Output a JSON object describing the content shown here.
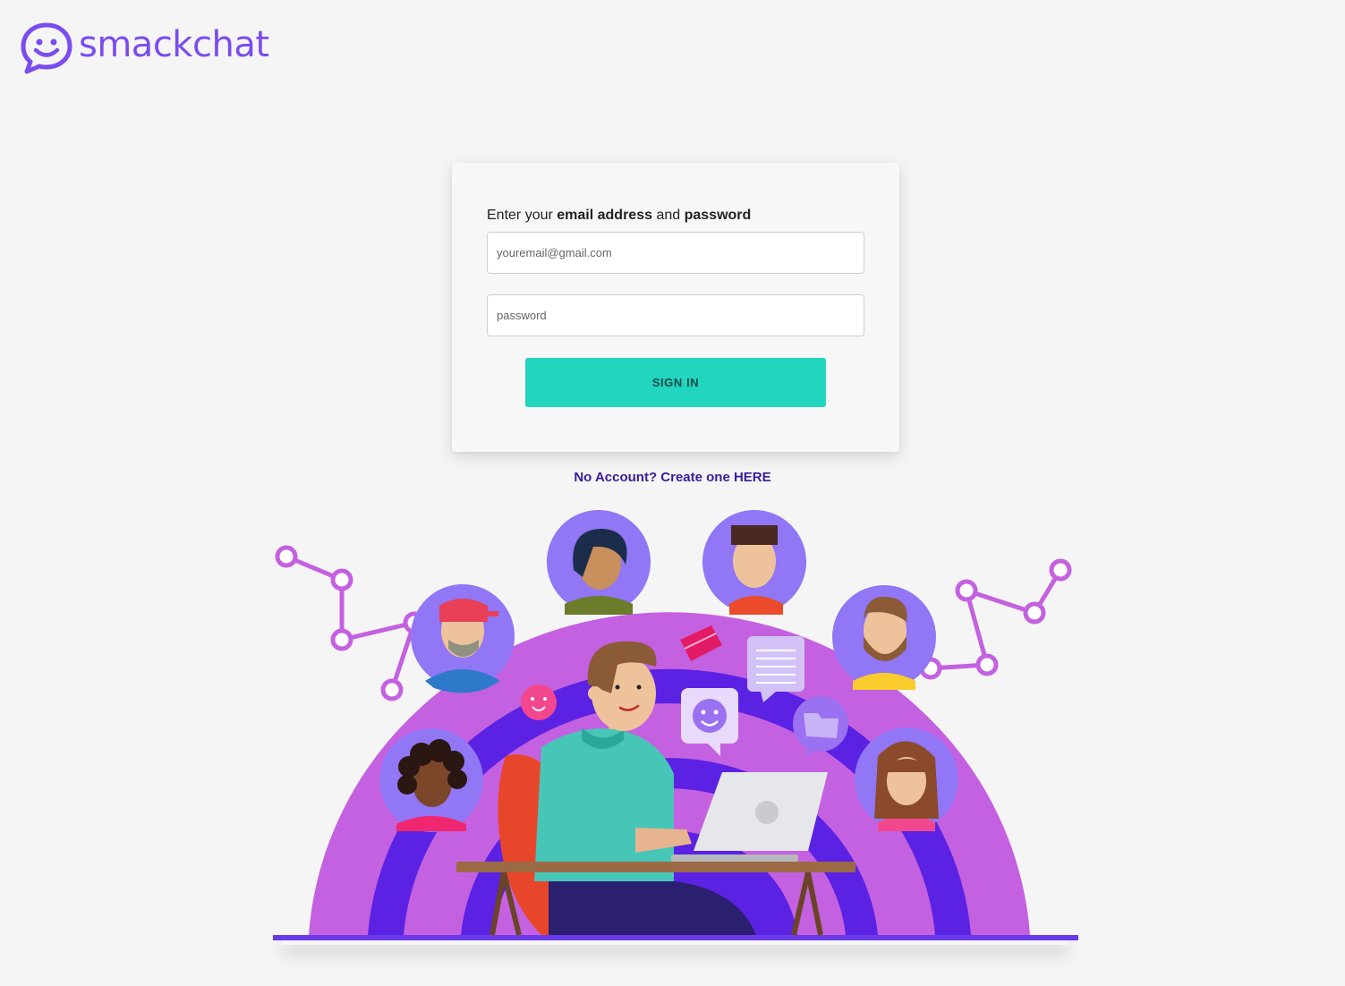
{
  "brand": {
    "name": "smackchat",
    "color": "#7a4cf0"
  },
  "login": {
    "prompt_prefix": "Enter your",
    "prompt_email": "email address",
    "prompt_and": "and",
    "prompt_password": "password",
    "email_placeholder": "youremail@gmail.com",
    "email_value": "",
    "password_placeholder": "password",
    "password_value": "",
    "submit_label": "SIGN IN",
    "submit_color": "#21d5bf"
  },
  "signup": {
    "link_text": "No Account? Create one HERE"
  },
  "illustration": {
    "icons": [
      "chat-bubble-smile-icon",
      "document-icon",
      "folder-icon",
      "emoji-icon",
      "laptop-icon",
      "network-node-icon"
    ],
    "avatar_bg_color": "#9176f5",
    "arc_colors": [
      "#c461e0",
      "#5b22e4"
    ]
  }
}
